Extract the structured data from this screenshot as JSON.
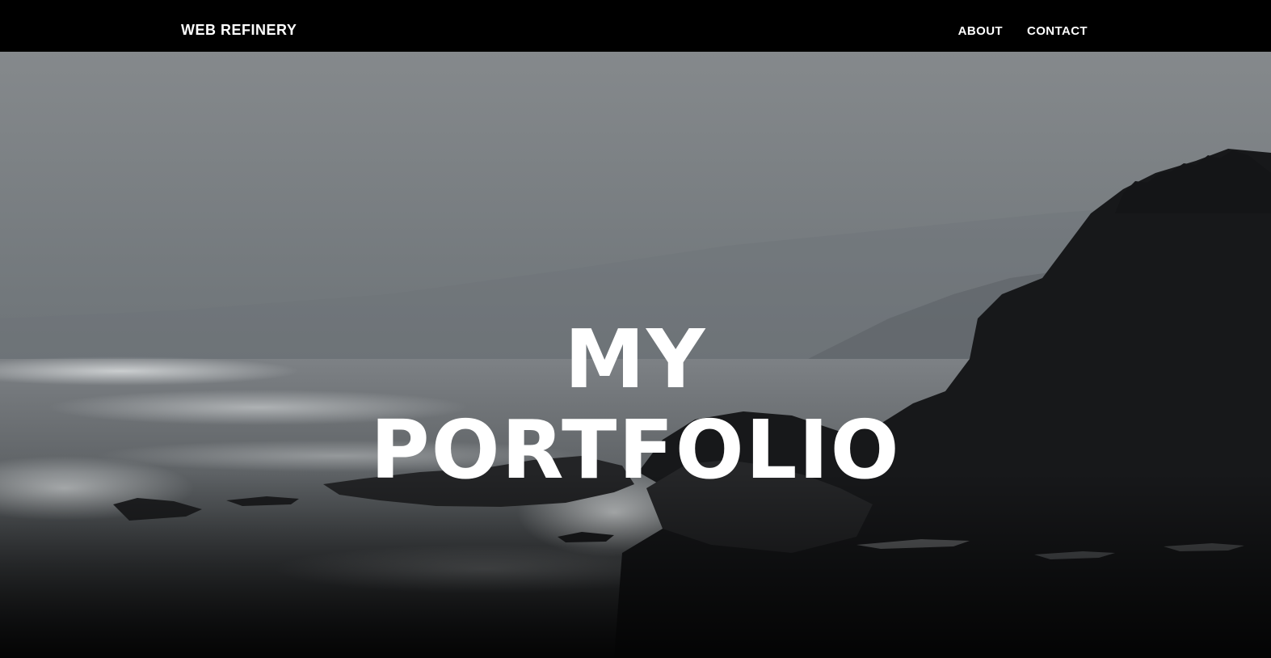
{
  "navbar": {
    "brand": "WEB REFINERY",
    "links": [
      {
        "label": "ABOUT"
      },
      {
        "label": "CONTACT"
      }
    ]
  },
  "hero": {
    "title_line1": "MY",
    "title_line2": "PORTFOLIO",
    "background": "stormy coastline photo (grayscale)"
  },
  "colors": {
    "navbar_bg": "#000000",
    "text": "#ffffff",
    "sky": "#7c8185",
    "rocks": "#17181a"
  }
}
